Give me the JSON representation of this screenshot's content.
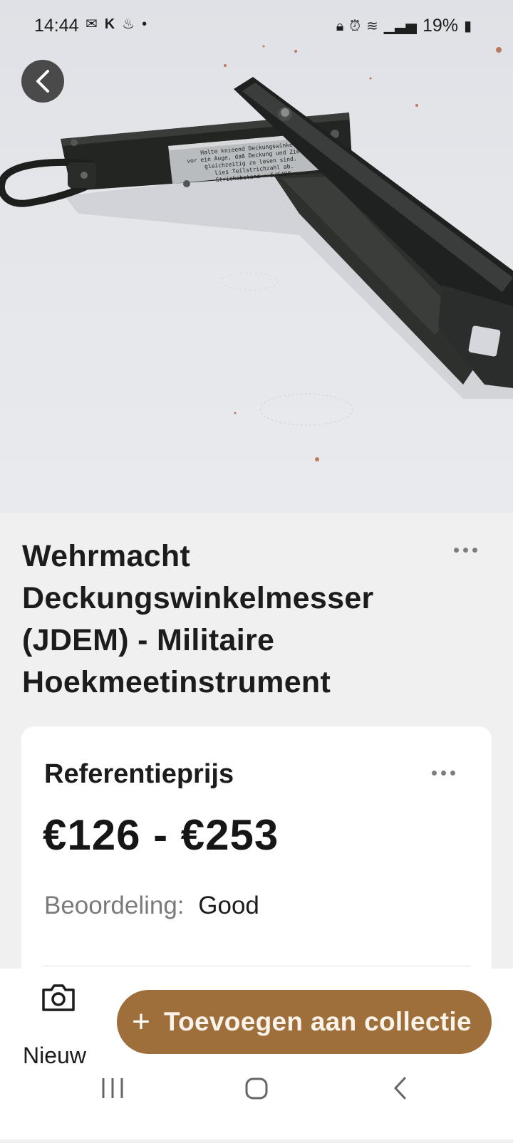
{
  "status_bar": {
    "time": "14:44",
    "left_icons": [
      "mail-icon",
      "k-icon",
      "flame-icon",
      "dot-icon"
    ],
    "battery": "19%",
    "right_icons": [
      "lock-icon",
      "alarm-icon",
      "wifi-icon",
      "signal-icon",
      "battery-icon"
    ]
  },
  "item": {
    "title": "Wehrmacht Deckungswinkelmesser (JDEM) - Militaire Hoekmeetinstrument",
    "photo_plate_text": [
      "Halte knieend Deckungswinkel",
      "vor ein Auge, daß Deckung und Ziel",
      "gleichzeitig zu lesen sind.",
      "Lies Teilstrichzahl ab.",
      "Strichabstand = 5/6400"
    ]
  },
  "price_card": {
    "title": "Referentieprijs",
    "price": "€126 - €253",
    "rating_label": "Beoordeling:",
    "rating_value": "Good"
  },
  "bottom_bar": {
    "new_label": "Nieuw",
    "add_label": "Toevoegen aan collectie",
    "add_color": "#9e6f3a"
  },
  "nav": [
    "recent-apps-icon",
    "home-icon",
    "back-icon"
  ]
}
